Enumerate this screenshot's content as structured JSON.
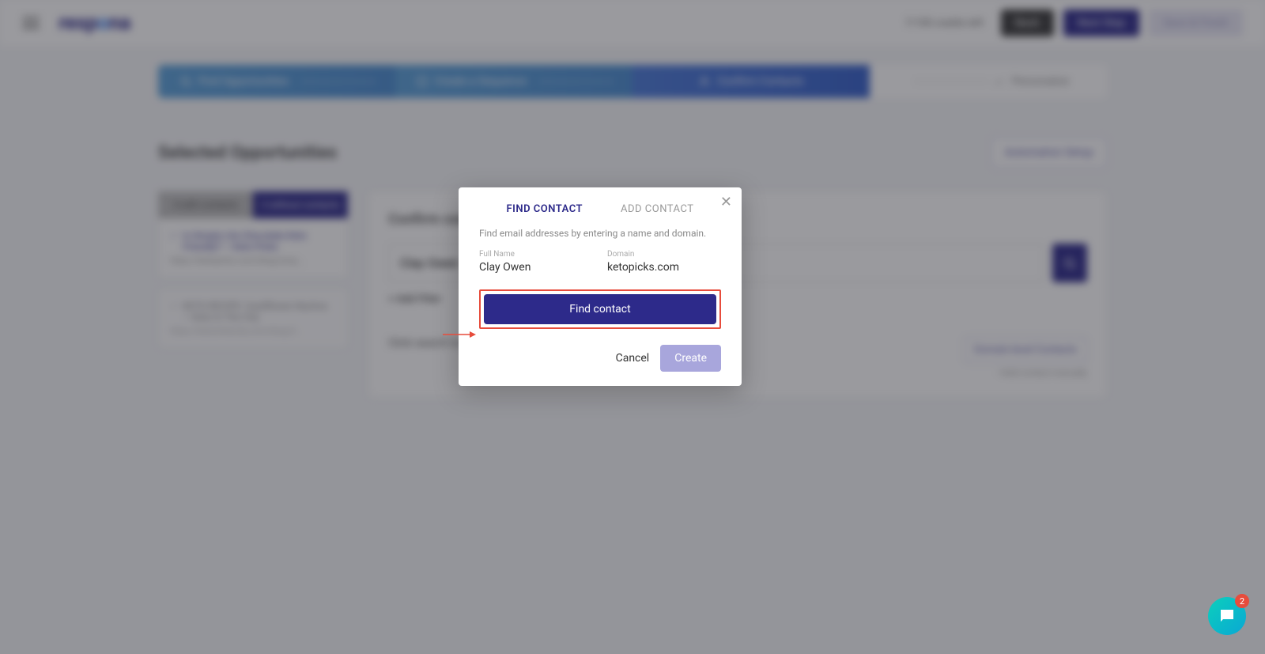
{
  "header": {
    "logo": "respona",
    "credits": "7/100 credits left",
    "back": "Back",
    "next": "Next Step",
    "save": "Save & Finish"
  },
  "stepper": {
    "s1": "Find Opportunities",
    "s2": "Create a Sequence",
    "s3": "Confirm Contacts",
    "s4": "Personalize"
  },
  "page": {
    "title": "Selected Opportunities",
    "automation": "Automation Setup"
  },
  "sidebar": {
    "tab_a": "4 with contacts",
    "tab_b": "2 without contacts",
    "opp1_title": "Is Simply Lite Chocolate Keto Friendly? — Keto Picks",
    "opp1_url": "https://ketopicks.com/blog/simp...",
    "opp2_title": "KETO RECIPE: Cauliflower Nachos — Keto In The City",
    "opp2_url": "https://ketointhecity.com/blog/2..."
  },
  "content": {
    "heading": "Confirm contact information",
    "search_value": "Clay Owen",
    "add_filter": "+ Add Filter",
    "click_search": "Click search to find relevant contacts",
    "domain_level": "Domain-level Contacts",
    "manual": "+Add contact manually"
  },
  "modal": {
    "tab_find": "FIND CONTACT",
    "tab_add": "ADD CONTACT",
    "desc": "Find email addresses by entering a name and domain.",
    "full_name_label": "Full Name",
    "full_name_value": "Clay Owen",
    "domain_label": "Domain",
    "domain_value": "ketopicks.com",
    "find_button": "Find contact",
    "cancel": "Cancel",
    "create": "Create"
  },
  "chat": {
    "badge": "2"
  }
}
